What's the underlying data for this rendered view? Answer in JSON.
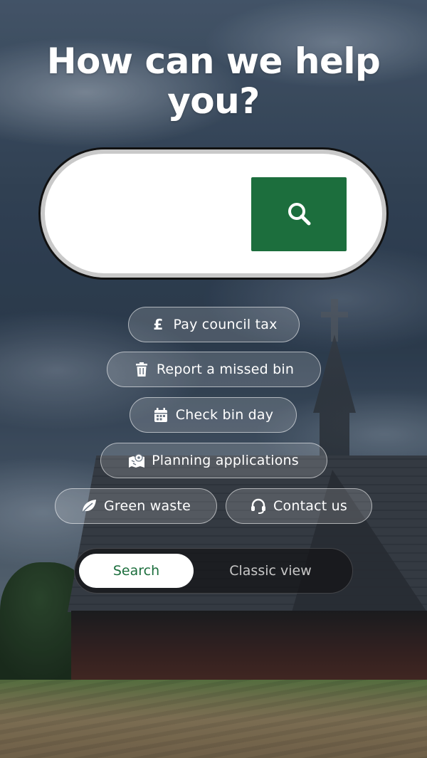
{
  "hero": {
    "title": "How can we help you?"
  },
  "search": {
    "value": "",
    "placeholder": ""
  },
  "quick_links": {
    "pay_council_tax": {
      "label": "Pay council tax",
      "icon": "pound-icon"
    },
    "report_missed_bin": {
      "label": "Report a missed bin",
      "icon": "trash-icon"
    },
    "check_bin_day": {
      "label": "Check bin day",
      "icon": "calendar-icon"
    },
    "planning_applications": {
      "label": "Planning applications",
      "icon": "map-pin-icon"
    },
    "green_waste": {
      "label": "Green waste",
      "icon": "leaf-icon"
    },
    "contact_us": {
      "label": "Contact us",
      "icon": "headset-icon"
    }
  },
  "view_toggle": {
    "active": "Search",
    "other": "Classic view"
  },
  "colors": {
    "accent": "#1c6e3d",
    "pill_border": "#ffffff",
    "toggle_bg": "#141416"
  }
}
